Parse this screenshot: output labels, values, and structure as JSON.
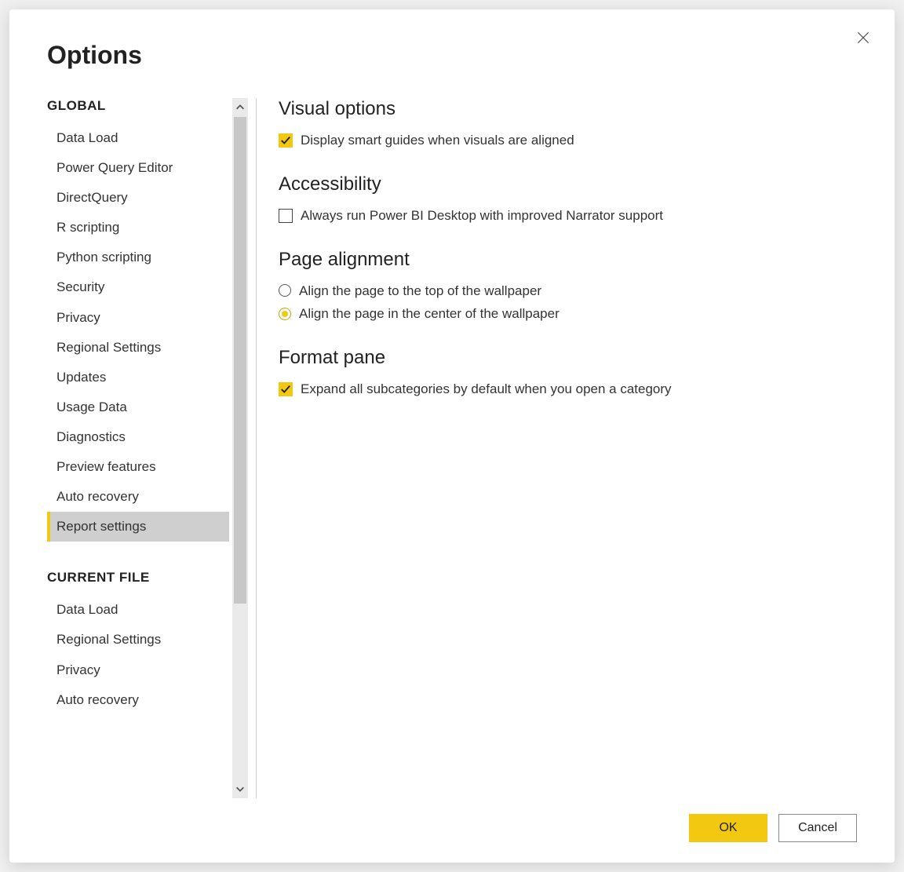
{
  "dialog": {
    "title": "Options"
  },
  "sidebar": {
    "sections": {
      "global": {
        "header": "GLOBAL",
        "items": [
          "Data Load",
          "Power Query Editor",
          "DirectQuery",
          "R scripting",
          "Python scripting",
          "Security",
          "Privacy",
          "Regional Settings",
          "Updates",
          "Usage Data",
          "Diagnostics",
          "Preview features",
          "Auto recovery",
          "Report settings"
        ],
        "selected_index": 13
      },
      "current_file": {
        "header": "CURRENT FILE",
        "items": [
          "Data Load",
          "Regional Settings",
          "Privacy",
          "Auto recovery"
        ]
      }
    }
  },
  "content": {
    "visual_options": {
      "title": "Visual options",
      "smart_guides": {
        "label": "Display smart guides when visuals are aligned",
        "checked": true
      }
    },
    "accessibility": {
      "title": "Accessibility",
      "narrator": {
        "label": "Always run Power BI Desktop with improved Narrator support",
        "checked": false
      }
    },
    "page_alignment": {
      "title": "Page alignment",
      "options": [
        "Align the page to the top of the wallpaper",
        "Align the page in the center of the wallpaper"
      ],
      "selected_index": 1
    },
    "format_pane": {
      "title": "Format pane",
      "expand_all": {
        "label": "Expand all subcategories by default when you open a category",
        "checked": true
      }
    }
  },
  "footer": {
    "ok": "OK",
    "cancel": "Cancel"
  },
  "colors": {
    "accent": "#f2c811"
  }
}
